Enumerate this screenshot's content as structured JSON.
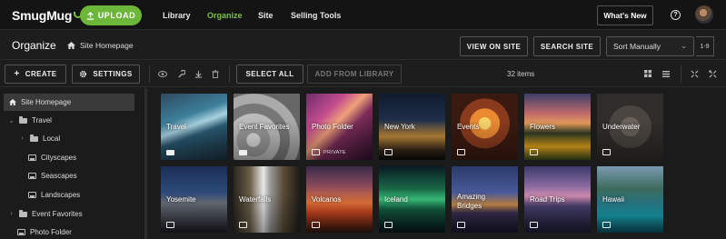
{
  "header": {
    "logo": "SmugMug",
    "upload_label": "UPLOAD",
    "nav": [
      "Library",
      "Organize",
      "Site",
      "Selling Tools"
    ],
    "active_nav": "Organize",
    "whats_new_label": "What's New",
    "help_label": "?"
  },
  "orgbar": {
    "title": "Organize",
    "breadcrumb": "Site Homepage",
    "view_on_site_label": "VIEW ON SITE",
    "search_site_label": "SEARCH SITE",
    "sort_value": "Sort Manually",
    "range": "1-9"
  },
  "toolbar": {
    "create_label": "CREATE",
    "settings_label": "SETTINGS",
    "select_all_label": "SELECT ALL",
    "add_from_library_label": "ADD FROM LIBRARY",
    "count": "32 items"
  },
  "sidebar": {
    "items": [
      {
        "label": "Site Homepage"
      },
      {
        "label": "Travel"
      },
      {
        "label": "Local"
      },
      {
        "label": "Cityscapes"
      },
      {
        "label": "Seascapes"
      },
      {
        "label": "Landscapes"
      },
      {
        "label": "Event Favorites"
      },
      {
        "label": "Photo Folder"
      }
    ]
  },
  "grid": {
    "tiles": [
      {
        "name": "Travel",
        "type": "folder",
        "tag": ""
      },
      {
        "name": "Event Favorites",
        "type": "folder",
        "tag": ""
      },
      {
        "name": "Photo Folder",
        "type": "gallery",
        "tag": "PRIVATE"
      },
      {
        "name": "New York",
        "type": "gallery",
        "tag": ""
      },
      {
        "name": "Events",
        "type": "gallery",
        "tag": ""
      },
      {
        "name": "Flowers",
        "type": "gallery",
        "tag": ""
      },
      {
        "name": "Underwater",
        "type": "gallery",
        "tag": ""
      },
      {
        "name": "Yosemite",
        "type": "gallery",
        "tag": ""
      },
      {
        "name": "Waterfalls",
        "type": "gallery",
        "tag": ""
      },
      {
        "name": "Volcanos",
        "type": "gallery",
        "tag": ""
      },
      {
        "name": "Iceland",
        "type": "gallery",
        "tag": ""
      },
      {
        "name": "Amazing\nBridges",
        "type": "gallery",
        "tag": ""
      },
      {
        "name": "Road Trips",
        "type": "gallery",
        "tag": ""
      },
      {
        "name": "Hawaii",
        "type": "gallery",
        "tag": ""
      }
    ]
  },
  "colors": {
    "accent": "#7ac143",
    "upload_button": "#6cb63a"
  }
}
